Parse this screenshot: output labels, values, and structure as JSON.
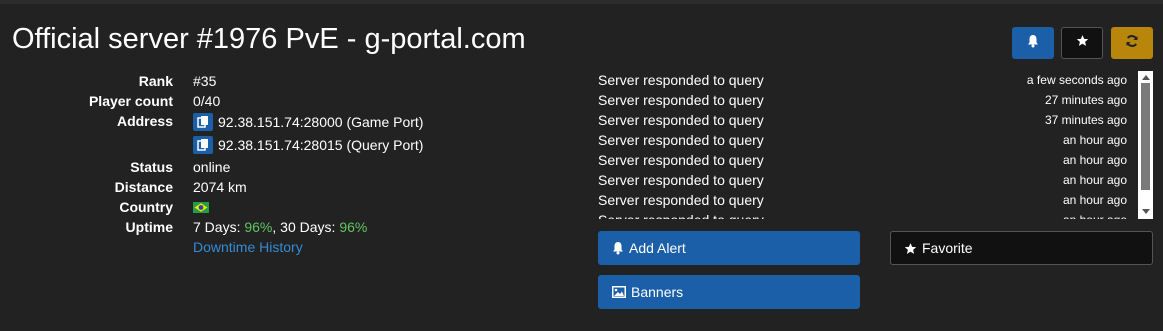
{
  "page_title": "Official server #1976 PvE - g-portal.com",
  "header_buttons": {
    "alert_icon": "bell-icon",
    "favorite_icon": "star-icon",
    "refresh_icon": "refresh-icon"
  },
  "info": {
    "rank_label": "Rank",
    "rank_value": "#35",
    "player_count_label": "Player count",
    "player_count_value": "0/40",
    "address_label": "Address",
    "address_game": "92.38.151.74:28000 (Game Port)",
    "address_query": "92.38.151.74:28015 (Query Port)",
    "status_label": "Status",
    "status_value": "online",
    "distance_label": "Distance",
    "distance_value": "2074 km",
    "country_label": "Country",
    "country_flag": "brazil-flag",
    "uptime_label": "Uptime",
    "uptime_7_prefix": "7 Days: ",
    "uptime_7_value": "96%",
    "uptime_sep": ", 30 Days: ",
    "uptime_30_value": "96%",
    "downtime_link": "Downtime History"
  },
  "log": [
    {
      "message": "Server responded to query",
      "time": "a few seconds ago"
    },
    {
      "message": "Server responded to query",
      "time": "27 minutes ago"
    },
    {
      "message": "Server responded to query",
      "time": "37 minutes ago"
    },
    {
      "message": "Server responded to query",
      "time": "an hour ago"
    },
    {
      "message": "Server responded to query",
      "time": "an hour ago"
    },
    {
      "message": "Server responded to query",
      "time": "an hour ago"
    },
    {
      "message": "Server responded to query",
      "time": "an hour ago"
    },
    {
      "message": "Server responded to query",
      "time": "an hour ago"
    }
  ],
  "actions": {
    "add_alert": "Add Alert",
    "banners": "Banners",
    "favorite": "Favorite"
  },
  "colors": {
    "background": "#222222",
    "primary": "#1a5fa8",
    "warning": "#b8860b",
    "success_text": "#62c462",
    "link": "#338bd6"
  }
}
